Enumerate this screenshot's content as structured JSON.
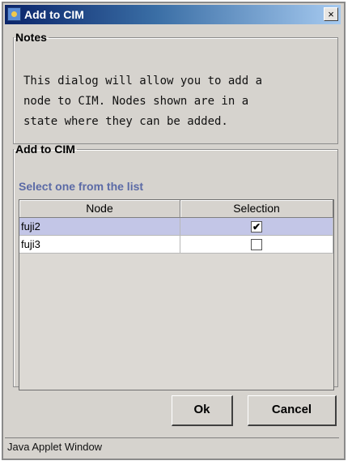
{
  "window": {
    "title": "Add to CIM",
    "close_label": "×",
    "app_icon": "java-dialog-icon"
  },
  "notes": {
    "legend": "Notes",
    "lines": [
      "This dialog will allow you to add a",
      "node to CIM.  Nodes shown are in a",
      "state where they can be added."
    ]
  },
  "add_to_cim": {
    "legend": "Add to CIM",
    "instruction": "Select one from the list",
    "columns": [
      "Node",
      "Selection"
    ],
    "rows": [
      {
        "node": "fuji2",
        "check": "✔",
        "selected": true
      },
      {
        "node": "fuji3",
        "check": "",
        "selected": false
      }
    ]
  },
  "buttons": {
    "ok": "Ok",
    "cancel": "Cancel"
  },
  "status": "Java Applet Window",
  "colors": {
    "title_gradient_start": "#0a246a",
    "title_gradient_end": "#a6caf0",
    "selected_row": "#c3c6e7",
    "instruction_text": "#5b6aa6",
    "panel": "#d6d3ce"
  }
}
